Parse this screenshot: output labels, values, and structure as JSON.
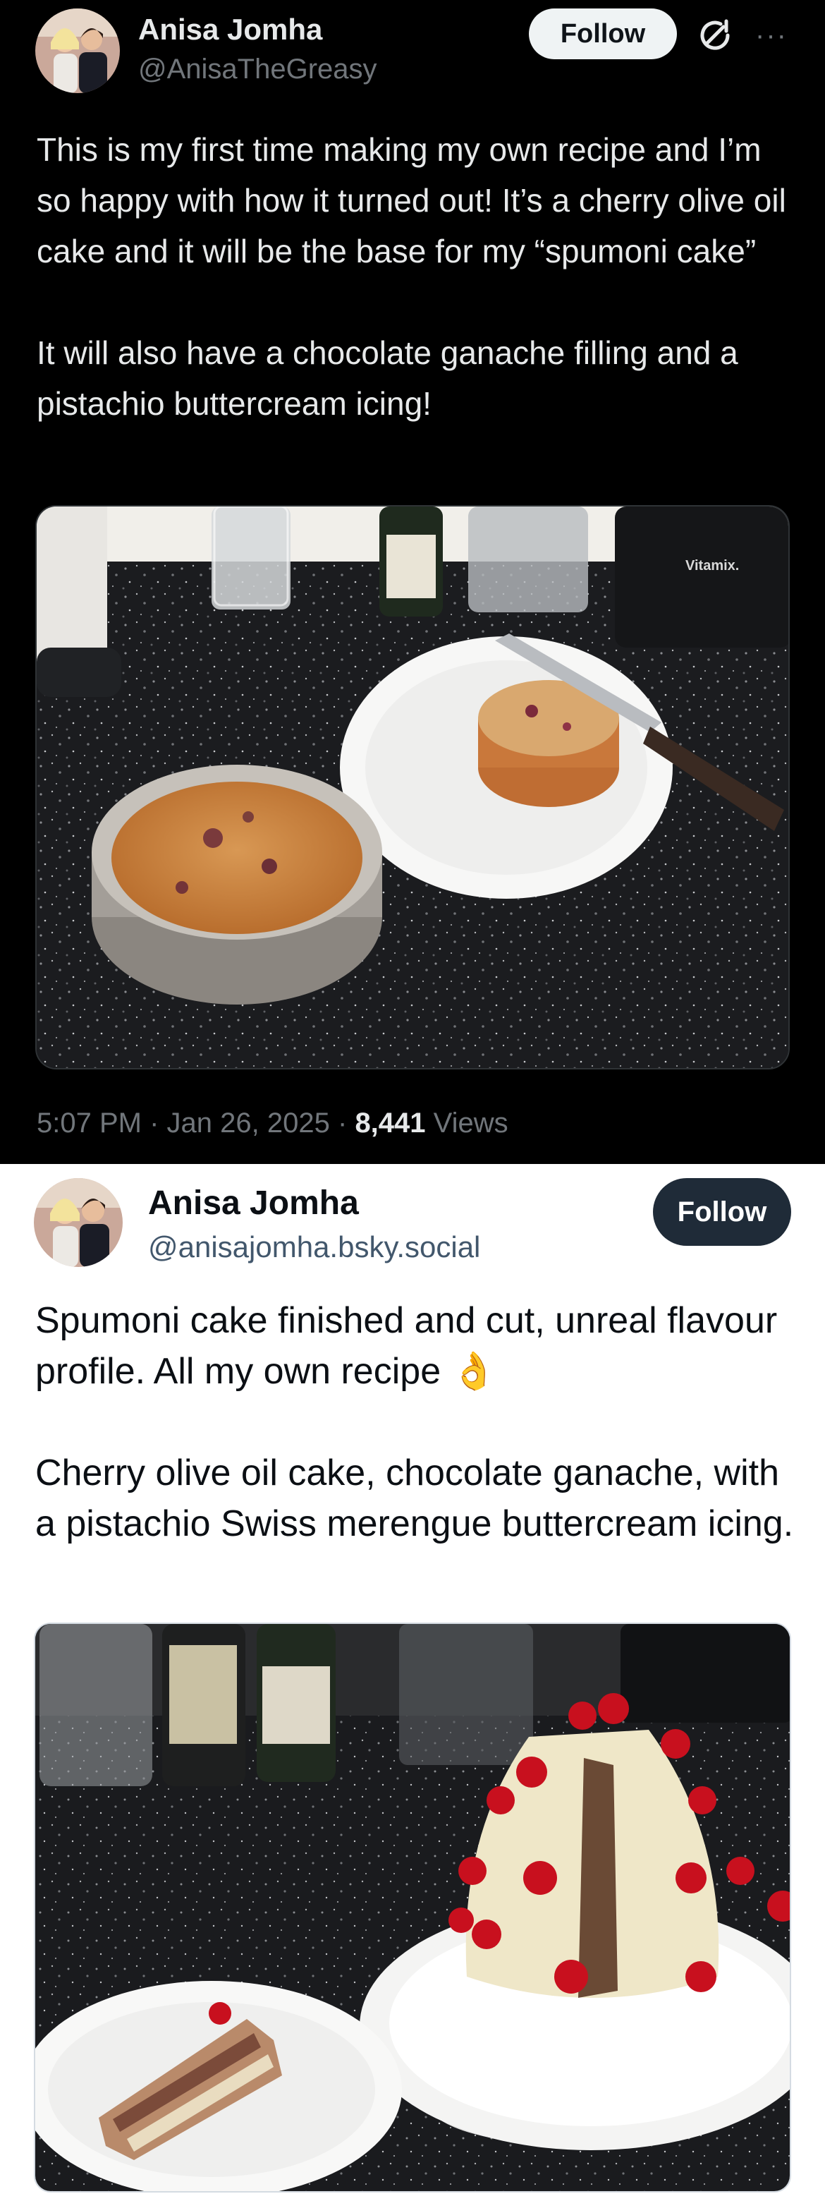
{
  "post1": {
    "author_name": "Anisa Jomha",
    "author_handle": "@AnisaTheGreasy",
    "follow_label": "Follow",
    "more_label": "···",
    "text_paragraphs": [
      "This is my first time making my own recipe and I’m so happy with how it turned out! It’s a cherry olive oil cake and it will be the base for my “spumoni cake”",
      "It will also have a chocolate ganache filling and a pistachio buttercream icing!"
    ],
    "time": "5:07 PM",
    "date": "Jan 26, 2025",
    "views_count": "8,441",
    "views_label": "Views",
    "separator": "·",
    "image_label": "Vitamix."
  },
  "post2": {
    "author_name": "Anisa Jomha",
    "author_handle": "@anisajomha.bsky.social",
    "follow_label": "Follow",
    "text_paragraphs": [
      "Spumoni cake finished and cut, unreal flavour profile. All my own recipe 👌",
      "Cherry olive oil cake, chocolate ganache, with a pistachio Swiss merengue buttercream icing."
    ]
  },
  "colors": {
    "dark_bg": "#000000",
    "dark_text": "#e7e9ea",
    "dark_muted": "#71767b",
    "light_bg": "#ffffff",
    "light_text": "#0b0f14",
    "light_muted": "#42576c",
    "bsky_follow_bg": "#1f2b38"
  },
  "icons": {
    "grok": "grok-icon",
    "more": "more-icon"
  }
}
